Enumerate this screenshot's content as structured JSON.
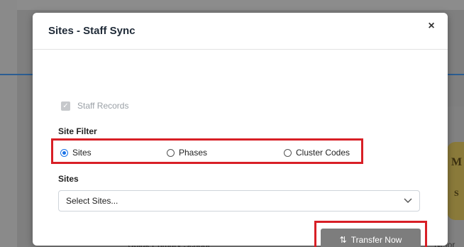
{
  "background": {
    "logo_letter_top": "M",
    "logo_letter_bottom": "S",
    "bottom_text": "Upiak Primary School",
    "bottom_text_right": "Nefor"
  },
  "modal": {
    "title": "Sites - Staff Sync",
    "close_icon": "×",
    "staff_records": {
      "label": "Staff Records",
      "checked": true,
      "disabled": true
    },
    "site_filter": {
      "heading": "Site Filter",
      "options": [
        {
          "label": "Sites",
          "checked": true
        },
        {
          "label": "Phases",
          "checked": false
        },
        {
          "label": "Cluster Codes",
          "checked": false
        }
      ]
    },
    "sites": {
      "heading": "Sites",
      "select_value": "Select Sites...",
      "chevron_icon": "chevron-down-icon"
    },
    "transfer_button": {
      "icon": "⇅",
      "label": "Transfer Now"
    }
  },
  "colors": {
    "highlight_border": "#d81f26",
    "accent_radio": "#1a73e8",
    "button_bg": "#7d7d7d"
  }
}
